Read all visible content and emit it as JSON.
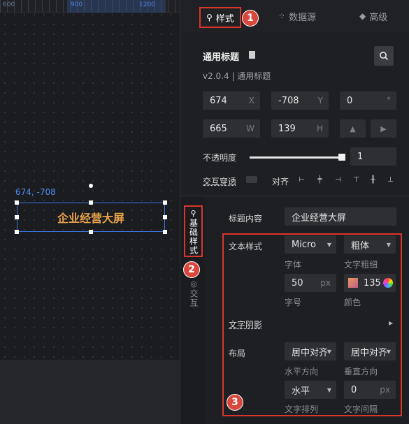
{
  "canvas": {
    "ruler_labels": [
      "600",
      "900",
      "1200"
    ],
    "coord_label": "674, -708",
    "component_text": "企业经营大屏"
  },
  "tabs": [
    {
      "label": "样式",
      "icon": "sliders-icon"
    },
    {
      "label": "数据源",
      "icon": "grid-dots-icon"
    },
    {
      "label": "高级",
      "icon": "cube-icon"
    }
  ],
  "badges": [
    "1",
    "2",
    "3"
  ],
  "component": {
    "name": "通用标题",
    "version": "v2.0.4 | 通用标题"
  },
  "position": {
    "x": "674",
    "x_unit": "X",
    "y": "-708",
    "y_unit": "Y",
    "rotation": "0",
    "rotation_unit": "°",
    "w": "665",
    "w_unit": "W",
    "h": "139",
    "h_unit": "H"
  },
  "opacity": {
    "label": "不透明度",
    "value": "1",
    "level": 1.0
  },
  "interaction": {
    "label": "交互穿透",
    "align_label": "对齐"
  },
  "side_tabs": {
    "basic": "基础样式",
    "interact": "交互"
  },
  "style": {
    "title_content_label": "标题内容",
    "title_content_value": "企业经营大屏",
    "text_style_label": "文本样式",
    "font_family": "Micro",
    "font_family_sub": "字体",
    "font_weight": "粗体",
    "font_weight_sub": "文字粗细",
    "font_size": "50",
    "font_size_unit": "px",
    "font_size_sub": "字号",
    "color_value": "135",
    "color_sub": "颜色",
    "shadow_label": "文字阴影",
    "layout_label": "布局",
    "h_align": "居中对齐",
    "h_align_sub": "水平方向",
    "v_align": "居中对齐",
    "v_align_sub": "垂直方向",
    "text_direction": "水平",
    "text_direction_sub": "文字排列",
    "letter_spacing": "0",
    "letter_spacing_unit": "px",
    "letter_spacing_sub": "文字间隔"
  },
  "colors": {
    "accent_red": "#d9352d",
    "selection_blue": "#3b78e7",
    "title_text": "#e9a24b"
  }
}
